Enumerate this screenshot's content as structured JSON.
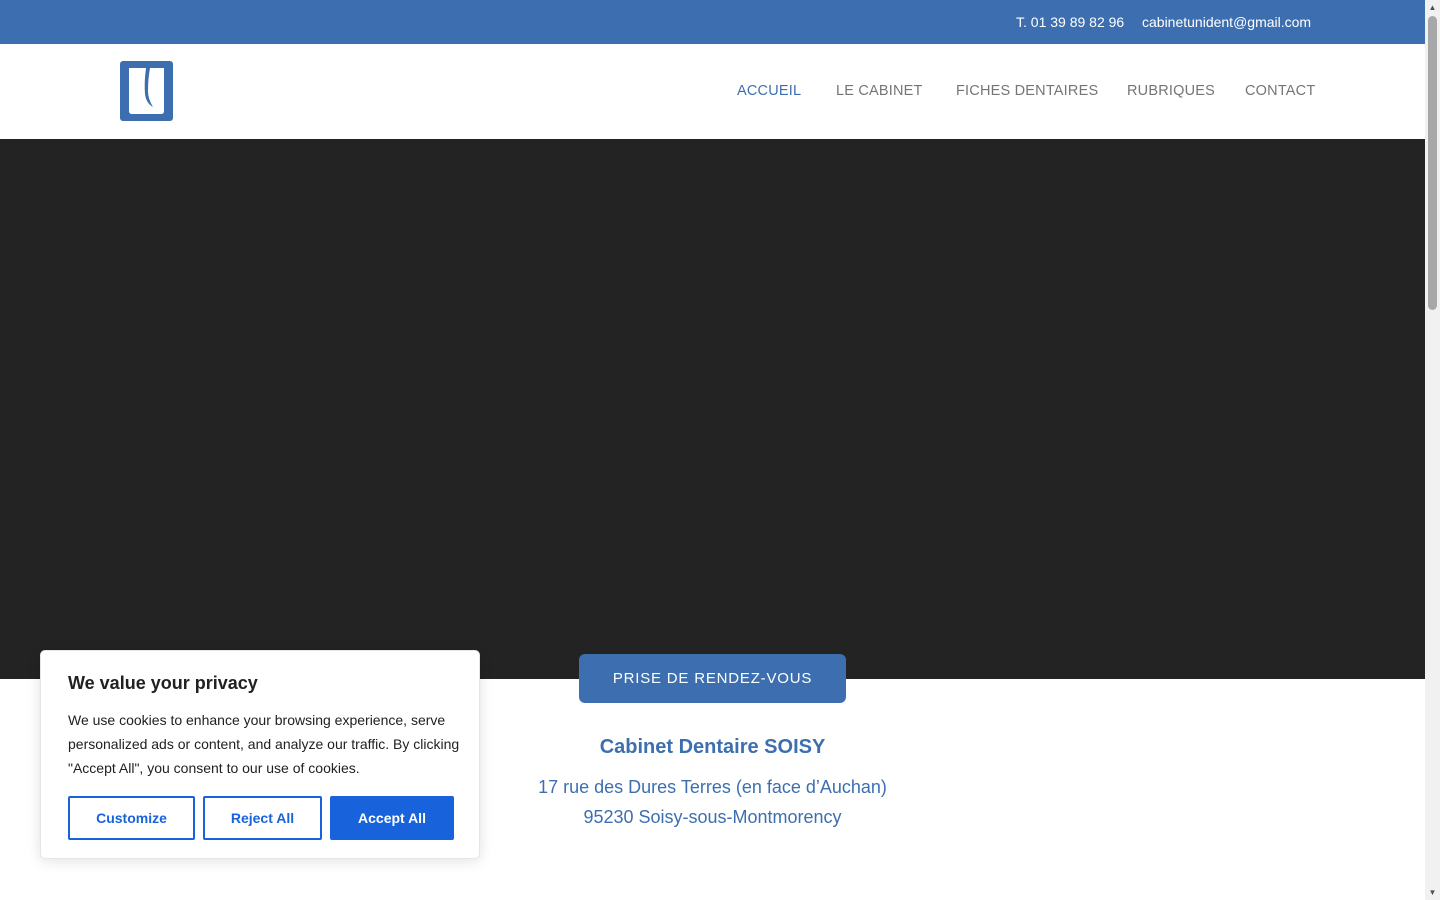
{
  "topbar": {
    "phone": "T. 01 39 89 82 96",
    "email": "cabinetunident@gmail.com"
  },
  "header": {
    "logo_icon": "tooth-logo-icon",
    "nav": {
      "accueil": "ACCUEIL",
      "cabinet": "LE CABINET",
      "fiches": "FICHES DENTAIRES",
      "rubriques": "RUBRIQUES",
      "contact": "CONTACT"
    },
    "active_item": "ACCUEIL"
  },
  "hero": {
    "cta_label": "PRISE DE RENDEZ-VOUS"
  },
  "info": {
    "title": "Cabinet Dentaire SOISY",
    "address_line1": "17 rue des Dures Terres (en face d’Auchan)",
    "address_line2": "95230 Soisy-sous-Montmorency"
  },
  "cookie_banner": {
    "title": "We value your privacy",
    "text": "We use cookies to enhance your browsing experience, serve personalized ads or content, and analyze our traffic. By clicking \"Accept All\", you consent to our use of cookies.",
    "customize_label": "Customize",
    "reject_label": "Reject All",
    "accept_label": "Accept All"
  },
  "colors": {
    "brand_blue": "#3d6fb0",
    "hero_dark": "#232323",
    "cookie_blue": "#1863dc",
    "nav_gray": "#757575"
  }
}
